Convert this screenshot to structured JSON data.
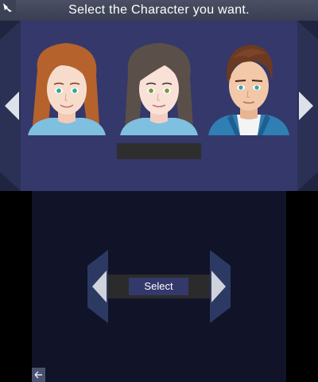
{
  "header": {
    "title": "Select the Character you want."
  },
  "characters": [
    {
      "hair": "auburn-long",
      "hair_color": "#b5622d",
      "eye_color": "#2aa89a",
      "shirt_color": "#7fbfe0"
    },
    {
      "hair": "brown-long",
      "hair_color": "#5a4f49",
      "eye_color": "#6e9a3c",
      "shirt_color": "#7fbfe0"
    },
    {
      "hair": "brown-short",
      "hair_color": "#6b3a22",
      "eye_color": "#3a9db0",
      "shirt_color": "#2f7fb5"
    }
  ],
  "selection": {
    "name": ""
  },
  "bottom": {
    "select_label": "Select"
  },
  "colors": {
    "panel": "#34386b",
    "header": "#44495c",
    "bottom_bg": "#111328",
    "arrow": "#dde2ea"
  },
  "icons": [
    "corner-pointer-icon",
    "arrow-left-icon",
    "arrow-right-icon",
    "back-arrow-icon"
  ]
}
